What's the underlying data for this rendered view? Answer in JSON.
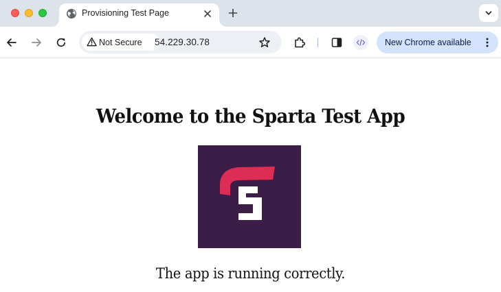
{
  "browser": {
    "tab": {
      "title": "Provisioning Test Page",
      "favicon": "globe-icon"
    },
    "toolbar": {
      "security_label": "Not Secure",
      "url": "54.229.30.78",
      "update_button_label": "New Chrome available"
    },
    "icons": {
      "back": "arrow-left-icon",
      "forward": "arrow-right-icon",
      "reload": "reload-icon",
      "warning": "warning-triangle-icon",
      "bookmark": "star-icon",
      "extensions": "puzzle-icon",
      "side_panel": "side-panel-icon",
      "devtools": "code-icon",
      "menu": "kebab-menu-icon",
      "tab_search": "chevron-down-icon",
      "new_tab": "plus-icon",
      "close_tab": "close-icon"
    },
    "colors": {
      "tabstrip_bg": "#dde3ea",
      "omnibox_bg": "#edf0f4",
      "update_button_bg": "#d3e3fd",
      "close_light": "#ff5f57",
      "minimize_light": "#febc2e",
      "maximize_light": "#28c840"
    }
  },
  "page": {
    "heading": "Welcome to the Sparta Test App",
    "status_message": "The app is running correctly.",
    "logo": {
      "name": "sparta-logo",
      "background_color": "#3b1d48",
      "accent_color": "#dd2d55",
      "letter_color": "#ffffff"
    }
  }
}
